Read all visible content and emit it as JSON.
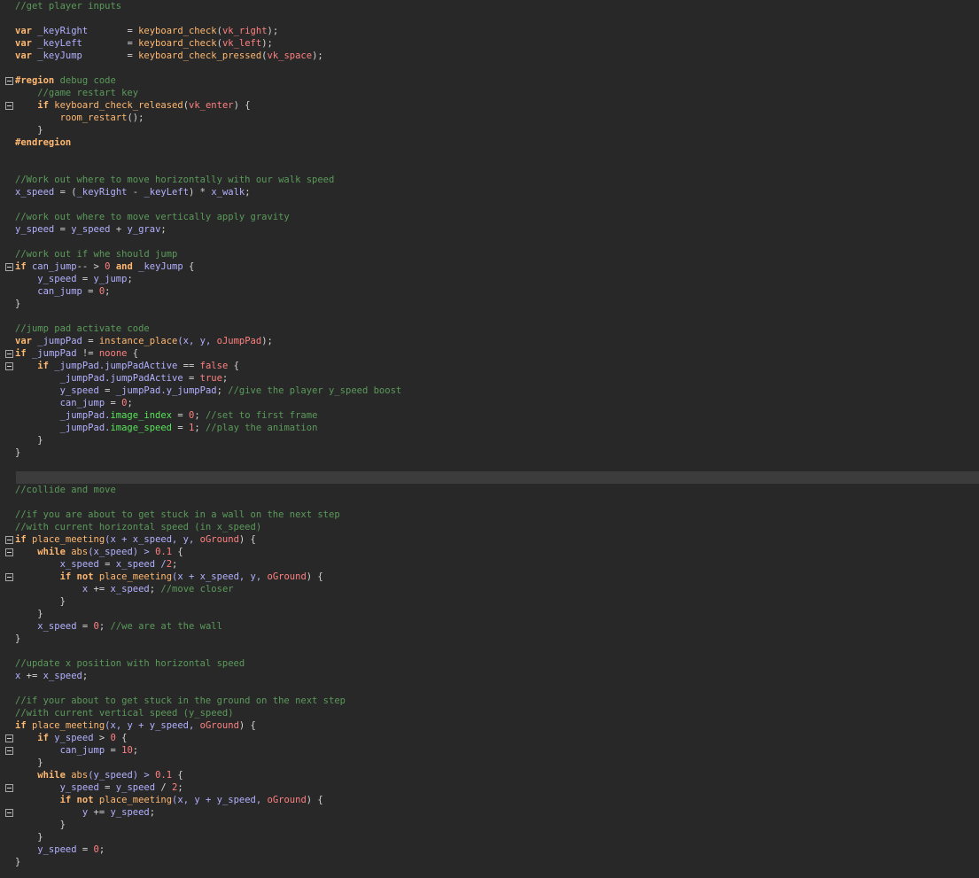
{
  "editor": {
    "lines": [
      [
        {
          "t": "//get player inputs",
          "c": "c"
        }
      ],
      [],
      [
        {
          "t": "var",
          "c": "k"
        },
        {
          "t": " _keyRight       ",
          "c": "v"
        },
        {
          "t": "= ",
          "c": "o"
        },
        {
          "t": "keyboard_check",
          "c": "f"
        },
        {
          "t": "(",
          "c": "p"
        },
        {
          "t": "vk_right",
          "c": "r"
        },
        {
          "t": ");",
          "c": "p"
        }
      ],
      [
        {
          "t": "var",
          "c": "k"
        },
        {
          "t": " _keyLeft        ",
          "c": "v"
        },
        {
          "t": "= ",
          "c": "o"
        },
        {
          "t": "keyboard_check",
          "c": "f"
        },
        {
          "t": "(",
          "c": "p"
        },
        {
          "t": "vk_left",
          "c": "r"
        },
        {
          "t": ");",
          "c": "p"
        }
      ],
      [
        {
          "t": "var",
          "c": "k"
        },
        {
          "t": " _keyJump        ",
          "c": "v"
        },
        {
          "t": "= ",
          "c": "o"
        },
        {
          "t": "keyboard_check_pressed",
          "c": "f"
        },
        {
          "t": "(",
          "c": "p"
        },
        {
          "t": "vk_space",
          "c": "r"
        },
        {
          "t": ");",
          "c": "p"
        }
      ],
      [],
      [
        {
          "t": "#region",
          "c": "d"
        },
        {
          "t": " debug code",
          "c": "c"
        }
      ],
      [
        {
          "t": "    //game restart key",
          "c": "c"
        }
      ],
      [
        {
          "t": "    ",
          "c": "p"
        },
        {
          "t": "if",
          "c": "k"
        },
        {
          "t": " ",
          "c": "p"
        },
        {
          "t": "keyboard_check_released",
          "c": "f"
        },
        {
          "t": "(",
          "c": "p"
        },
        {
          "t": "vk_enter",
          "c": "r"
        },
        {
          "t": ") {",
          "c": "p"
        }
      ],
      [
        {
          "t": "        ",
          "c": "p"
        },
        {
          "t": "room_restart",
          "c": "f"
        },
        {
          "t": "();",
          "c": "p"
        }
      ],
      [
        {
          "t": "    }",
          "c": "p"
        }
      ],
      [
        {
          "t": "#endregion",
          "c": "d"
        }
      ],
      [],
      [],
      [
        {
          "t": "//Work out where to move horizontally with our walk speed",
          "c": "c"
        }
      ],
      [
        {
          "t": "x_speed",
          "c": "v"
        },
        {
          "t": " = (",
          "c": "o"
        },
        {
          "t": "_keyRight",
          "c": "v"
        },
        {
          "t": " - ",
          "c": "o"
        },
        {
          "t": "_keyLeft",
          "c": "v"
        },
        {
          "t": ") * ",
          "c": "o"
        },
        {
          "t": "x_walk",
          "c": "v"
        },
        {
          "t": ";",
          "c": "p"
        }
      ],
      [],
      [
        {
          "t": "//work out where to move vertically apply gravity",
          "c": "c"
        }
      ],
      [
        {
          "t": "y_speed",
          "c": "v"
        },
        {
          "t": " = ",
          "c": "o"
        },
        {
          "t": "y_speed",
          "c": "v"
        },
        {
          "t": " + ",
          "c": "o"
        },
        {
          "t": "y_grav",
          "c": "v"
        },
        {
          "t": ";",
          "c": "p"
        }
      ],
      [],
      [
        {
          "t": "//work out if whe should jump",
          "c": "c"
        }
      ],
      [
        {
          "t": "if",
          "c": "k"
        },
        {
          "t": " can_jump",
          "c": "v"
        },
        {
          "t": "-- > ",
          "c": "o"
        },
        {
          "t": "0",
          "c": "n"
        },
        {
          "t": " and",
          "c": "k"
        },
        {
          "t": " _keyJump",
          "c": "v"
        },
        {
          "t": " {",
          "c": "p"
        }
      ],
      [
        {
          "t": "    y_speed",
          "c": "v"
        },
        {
          "t": " = ",
          "c": "o"
        },
        {
          "t": "y_jump",
          "c": "v"
        },
        {
          "t": ";",
          "c": "p"
        }
      ],
      [
        {
          "t": "    can_jump",
          "c": "v"
        },
        {
          "t": " = ",
          "c": "o"
        },
        {
          "t": "0",
          "c": "n"
        },
        {
          "t": ";",
          "c": "p"
        }
      ],
      [
        {
          "t": "}",
          "c": "p"
        }
      ],
      [],
      [
        {
          "t": "//jump pad activate code",
          "c": "c"
        }
      ],
      [
        {
          "t": "var",
          "c": "k"
        },
        {
          "t": " _jumpPad",
          "c": "v"
        },
        {
          "t": " = ",
          "c": "o"
        },
        {
          "t": "instance_place",
          "c": "f"
        },
        {
          "t": "(x, y, ",
          "c": "v"
        },
        {
          "t": "oJumpPad",
          "c": "r"
        },
        {
          "t": ");",
          "c": "p"
        }
      ],
      [
        {
          "t": "if",
          "c": "k"
        },
        {
          "t": " _jumpPad",
          "c": "v"
        },
        {
          "t": " != ",
          "c": "o"
        },
        {
          "t": "noone",
          "c": "r"
        },
        {
          "t": " {",
          "c": "p"
        }
      ],
      [
        {
          "t": "    ",
          "c": "p"
        },
        {
          "t": "if",
          "c": "k"
        },
        {
          "t": " _jumpPad.jumpPadActive",
          "c": "v"
        },
        {
          "t": " == ",
          "c": "o"
        },
        {
          "t": "false",
          "c": "r"
        },
        {
          "t": " {",
          "c": "p"
        }
      ],
      [
        {
          "t": "        _jumpPad.jumpPadActive",
          "c": "v"
        },
        {
          "t": " = ",
          "c": "o"
        },
        {
          "t": "true",
          "c": "r"
        },
        {
          "t": ";",
          "c": "p"
        }
      ],
      [
        {
          "t": "        y_speed",
          "c": "v"
        },
        {
          "t": " = ",
          "c": "o"
        },
        {
          "t": "_jumpPad.y_jumpPad",
          "c": "v"
        },
        {
          "t": "; ",
          "c": "p"
        },
        {
          "t": "//give the player y_speed boost",
          "c": "c"
        }
      ],
      [
        {
          "t": "        can_jump",
          "c": "v"
        },
        {
          "t": " = ",
          "c": "o"
        },
        {
          "t": "0",
          "c": "n"
        },
        {
          "t": ";",
          "c": "p"
        }
      ],
      [
        {
          "t": "        _jumpPad.",
          "c": "v"
        },
        {
          "t": "image_index",
          "c": "iv"
        },
        {
          "t": " = ",
          "c": "o"
        },
        {
          "t": "0",
          "c": "n"
        },
        {
          "t": "; ",
          "c": "p"
        },
        {
          "t": "//set to first frame",
          "c": "c"
        }
      ],
      [
        {
          "t": "        _jumpPad.",
          "c": "v"
        },
        {
          "t": "image_speed",
          "c": "iv"
        },
        {
          "t": " = ",
          "c": "o"
        },
        {
          "t": "1",
          "c": "n"
        },
        {
          "t": "; ",
          "c": "p"
        },
        {
          "t": "//play the animation",
          "c": "c"
        }
      ],
      [
        {
          "t": "    }",
          "c": "p"
        }
      ],
      [
        {
          "t": "}",
          "c": "p"
        }
      ],
      [],
      [],
      [
        {
          "t": "//collide and move",
          "c": "c"
        }
      ],
      [],
      [
        {
          "t": "//if you are about to get stuck in a wall on the next step",
          "c": "c"
        }
      ],
      [
        {
          "t": "//with current horizontal speed (in x_speed)",
          "c": "c"
        }
      ],
      [
        {
          "t": "if",
          "c": "k"
        },
        {
          "t": " ",
          "c": "p"
        },
        {
          "t": "place_meeting",
          "c": "f"
        },
        {
          "t": "(x + x_speed, y, ",
          "c": "v"
        },
        {
          "t": "oGround",
          "c": "r"
        },
        {
          "t": ") {",
          "c": "p"
        }
      ],
      [
        {
          "t": "    ",
          "c": "p"
        },
        {
          "t": "while",
          "c": "k"
        },
        {
          "t": " ",
          "c": "p"
        },
        {
          "t": "abs",
          "c": "f"
        },
        {
          "t": "(x_speed) > ",
          "c": "v"
        },
        {
          "t": "0.1",
          "c": "n"
        },
        {
          "t": " {",
          "c": "p"
        }
      ],
      [
        {
          "t": "        x_speed",
          "c": "v"
        },
        {
          "t": " = ",
          "c": "o"
        },
        {
          "t": "x_speed /",
          "c": "v"
        },
        {
          "t": "2",
          "c": "n"
        },
        {
          "t": ";",
          "c": "p"
        }
      ],
      [
        {
          "t": "        ",
          "c": "p"
        },
        {
          "t": "if",
          "c": "k"
        },
        {
          "t": " not",
          "c": "k"
        },
        {
          "t": " ",
          "c": "p"
        },
        {
          "t": "place_meeting",
          "c": "f"
        },
        {
          "t": "(x + x_speed, y, ",
          "c": "v"
        },
        {
          "t": "oGround",
          "c": "r"
        },
        {
          "t": ") {",
          "c": "p"
        }
      ],
      [
        {
          "t": "            x",
          "c": "v"
        },
        {
          "t": " += ",
          "c": "o"
        },
        {
          "t": "x_speed",
          "c": "v"
        },
        {
          "t": "; ",
          "c": "p"
        },
        {
          "t": "//move closer",
          "c": "c"
        }
      ],
      [
        {
          "t": "        }",
          "c": "p"
        }
      ],
      [
        {
          "t": "    }",
          "c": "p"
        }
      ],
      [
        {
          "t": "    x_speed",
          "c": "v"
        },
        {
          "t": " = ",
          "c": "o"
        },
        {
          "t": "0",
          "c": "n"
        },
        {
          "t": "; ",
          "c": "p"
        },
        {
          "t": "//we are at the wall",
          "c": "c"
        }
      ],
      [
        {
          "t": "}",
          "c": "p"
        }
      ],
      [],
      [
        {
          "t": "//update x position with horizontal speed",
          "c": "c"
        }
      ],
      [
        {
          "t": "x",
          "c": "v"
        },
        {
          "t": " += ",
          "c": "o"
        },
        {
          "t": "x_speed",
          "c": "v"
        },
        {
          "t": ";",
          "c": "p"
        }
      ],
      [],
      [
        {
          "t": "//if your about to get stuck in the ground on the next step",
          "c": "c"
        }
      ],
      [
        {
          "t": "//with current vertical speed (y_speed)",
          "c": "c"
        }
      ],
      [
        {
          "t": "if",
          "c": "k"
        },
        {
          "t": " ",
          "c": "p"
        },
        {
          "t": "place_meeting",
          "c": "f"
        },
        {
          "t": "(x, y + y_speed, ",
          "c": "v"
        },
        {
          "t": "oGround",
          "c": "r"
        },
        {
          "t": ") {",
          "c": "p"
        }
      ],
      [
        {
          "t": "    ",
          "c": "p"
        },
        {
          "t": "if",
          "c": "k"
        },
        {
          "t": " y_speed",
          "c": "v"
        },
        {
          "t": " > ",
          "c": "o"
        },
        {
          "t": "0",
          "c": "n"
        },
        {
          "t": " {",
          "c": "p"
        }
      ],
      [
        {
          "t": "        can_jump",
          "c": "v"
        },
        {
          "t": " = ",
          "c": "o"
        },
        {
          "t": "10",
          "c": "n"
        },
        {
          "t": ";",
          "c": "p"
        }
      ],
      [
        {
          "t": "    }",
          "c": "p"
        }
      ],
      [
        {
          "t": "    ",
          "c": "p"
        },
        {
          "t": "while",
          "c": "k"
        },
        {
          "t": " ",
          "c": "p"
        },
        {
          "t": "abs",
          "c": "f"
        },
        {
          "t": "(y_speed) > ",
          "c": "v"
        },
        {
          "t": "0.1",
          "c": "n"
        },
        {
          "t": " {",
          "c": "p"
        }
      ],
      [
        {
          "t": "        y_speed",
          "c": "v"
        },
        {
          "t": " = ",
          "c": "o"
        },
        {
          "t": "y_speed",
          "c": "v"
        },
        {
          "t": " / ",
          "c": "o"
        },
        {
          "t": "2",
          "c": "n"
        },
        {
          "t": ";",
          "c": "p"
        }
      ],
      [
        {
          "t": "        ",
          "c": "p"
        },
        {
          "t": "if",
          "c": "k"
        },
        {
          "t": " not",
          "c": "k"
        },
        {
          "t": " ",
          "c": "p"
        },
        {
          "t": "place_meeting",
          "c": "f"
        },
        {
          "t": "(x, y + y_speed, ",
          "c": "v"
        },
        {
          "t": "oGround",
          "c": "r"
        },
        {
          "t": ") {",
          "c": "p"
        }
      ],
      [
        {
          "t": "            y",
          "c": "v"
        },
        {
          "t": " += ",
          "c": "o"
        },
        {
          "t": "y_speed",
          "c": "v"
        },
        {
          "t": ";",
          "c": "p"
        }
      ],
      [
        {
          "t": "        }",
          "c": "p"
        }
      ],
      [
        {
          "t": "    }",
          "c": "p"
        }
      ],
      [
        {
          "t": "    y_speed",
          "c": "v"
        },
        {
          "t": " = ",
          "c": "o"
        },
        {
          "t": "0",
          "c": "n"
        },
        {
          "t": ";",
          "c": "p"
        }
      ],
      [
        {
          "t": "}",
          "c": "p"
        }
      ]
    ],
    "fold_lines": [
      6,
      8,
      21,
      28,
      29,
      43,
      44,
      46,
      59,
      60,
      63,
      65
    ],
    "current_line": 38,
    "colors": {
      "background": "#282828",
      "comment": "#5b9a5b",
      "keyword": "#ffb871",
      "variable": "#b2b1ff",
      "number": "#ff8080",
      "current_line": "#3c3c3c"
    }
  }
}
